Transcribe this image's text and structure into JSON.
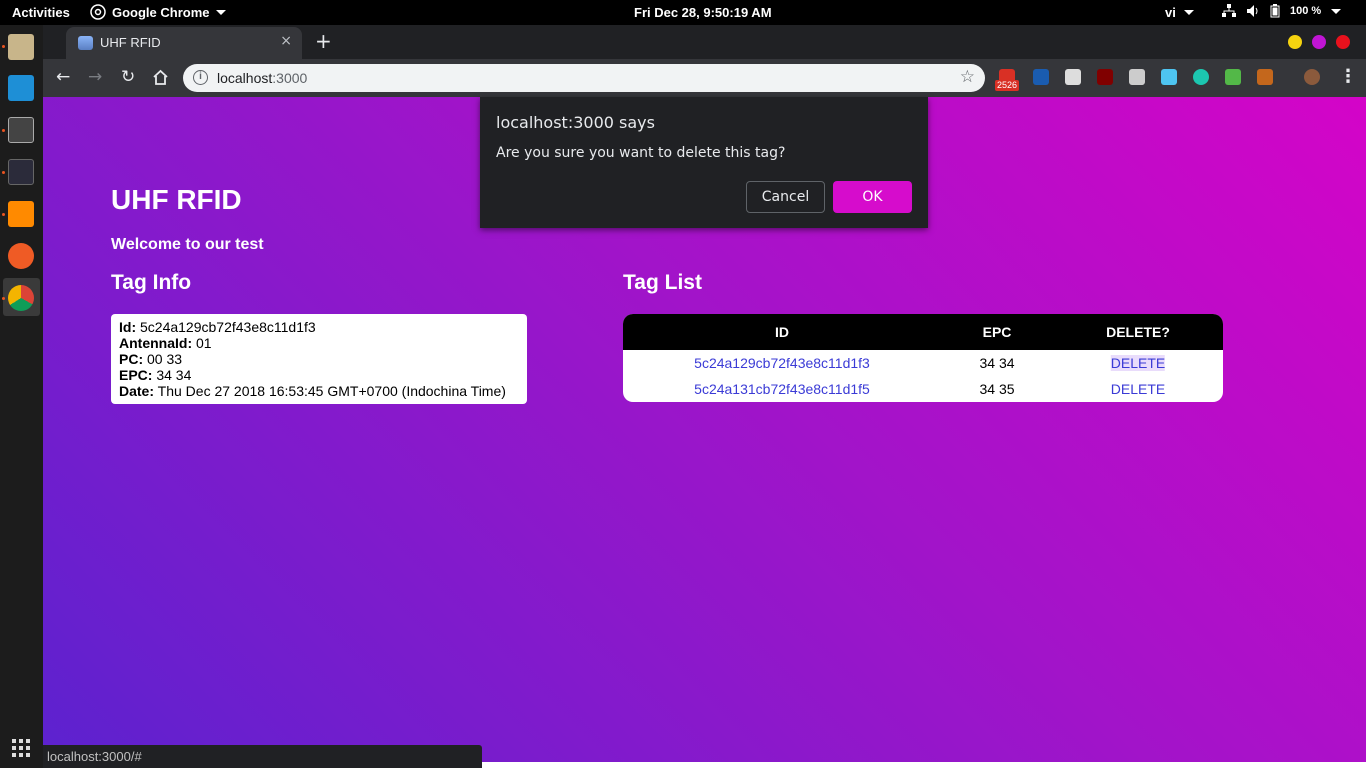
{
  "system_bar": {
    "activities": "Activities",
    "app_name": "Google Chrome",
    "clock": "Fri Dec 28,  9:50:19 AM",
    "input_method": "vi",
    "battery": "100 %"
  },
  "dock": {
    "items": [
      "files-icon",
      "downloader-icon",
      "texmaker-icon",
      "terminal-icon",
      "sublime-text-icon",
      "postman-icon",
      "chrome-icon"
    ],
    "apps_grid_icon": "show-applications-icon"
  },
  "browser": {
    "tab_title": "UHF RFID",
    "tab_close": "×",
    "new_tab": "+",
    "url_host": "localhost",
    "url_port": ":3000",
    "extension_badge": "2526",
    "status_url": "localhost:3000/#",
    "window_buttons": {
      "minimize": "#f5d30f",
      "maximize": "#c015d4",
      "close": "#e8111d"
    }
  },
  "page": {
    "title": "UHF RFID",
    "welcome": "Welcome to our test",
    "tag_info_heading": "Tag Info",
    "tag_list_heading": "Tag List",
    "tag_info": {
      "id_label": "Id:",
      "id": "5c24a129cb72f43e8c11d1f3",
      "antenna_label": "AntennaId:",
      "antenna": "01",
      "pc_label": "PC:",
      "pc": "00 33",
      "epc_label": "EPC:",
      "epc": "34 34",
      "date_label": "Date:",
      "date": "Thu Dec 27 2018 16:53:45 GMT+0700 (Indochina Time)"
    },
    "tag_table": {
      "headers": [
        "ID",
        "EPC",
        "DELETE?"
      ],
      "rows": [
        {
          "id": "5c24a129cb72f43e8c11d1f3",
          "epc": "34 34",
          "action": "DELETE"
        },
        {
          "id": "5c24a131cb72f43e8c11d1f5",
          "epc": "34 35",
          "action": "DELETE"
        }
      ]
    }
  },
  "dialog": {
    "title": "localhost:3000 says",
    "message": "Are you sure you want to delete this tag?",
    "cancel_label": "Cancel",
    "ok_label": "OK"
  }
}
